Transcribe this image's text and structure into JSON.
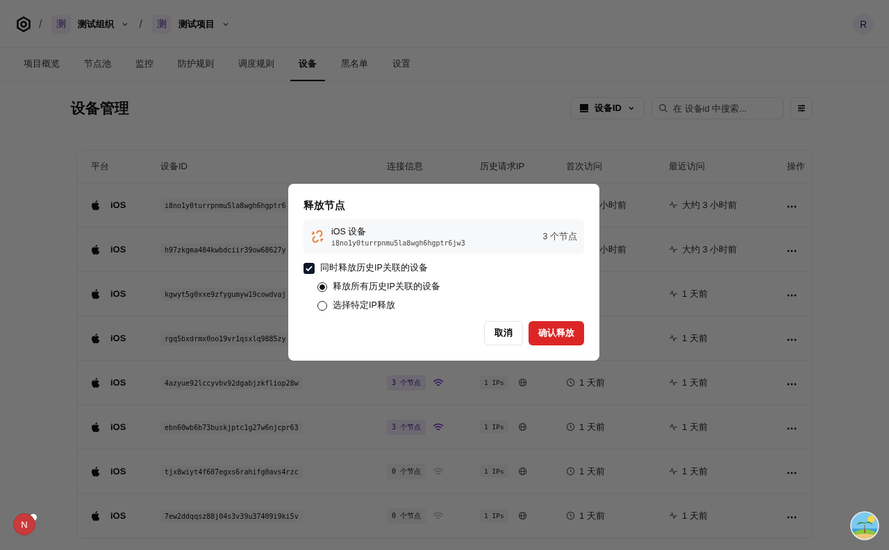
{
  "topbar": {
    "separator": "/",
    "org": {
      "badge": "测",
      "name": "测试组织"
    },
    "project": {
      "badge": "测",
      "name": "测试项目"
    },
    "avatar": "R"
  },
  "tabs": [
    {
      "label": "项目概览",
      "selected": false
    },
    {
      "label": "节点池",
      "selected": false
    },
    {
      "label": "监控",
      "selected": false
    },
    {
      "label": "防护规则",
      "selected": false
    },
    {
      "label": "调度规则",
      "selected": false
    },
    {
      "label": "设备",
      "selected": true
    },
    {
      "label": "黑名单",
      "selected": false
    },
    {
      "label": "设置",
      "selected": false
    }
  ],
  "page": {
    "title": "设备管理",
    "filter": "设备ID",
    "search": {
      "placeholder": "在 设备id 中搜索..."
    }
  },
  "table": {
    "columns": [
      "平台",
      "设备ID",
      "连接信息",
      "历史请求IP",
      "首次访问",
      "最近访问",
      "操作"
    ],
    "rows": [
      {
        "platform": "iOS",
        "device_id": "i8no1y0turrpnmu5la8wgh6hgptr6",
        "first_visit": "小时前",
        "last_visit": "大约 3 小时前"
      },
      {
        "platform": "iOS",
        "device_id": "h97zkgma484kwbdciir39ow68627y",
        "first_visit": "小时前",
        "last_visit": "大约 3 小时前"
      },
      {
        "platform": "iOS",
        "device_id": "kgwyt5g0xxe9zfygumyw19cowdvaj",
        "last_visit": "1 天前"
      },
      {
        "platform": "iOS",
        "device_id": "rgq5bxdrmx0oo19vr1qsxlq9885zy",
        "last_visit": "1 天前"
      },
      {
        "platform": "iOS",
        "device_id": "4azyue92lccyvbv92dgabjzkfliop28w",
        "nodes": "3 个节点",
        "online": true,
        "ips": "1 IPs",
        "first_visit": "1 天前",
        "last_visit": "1 天前"
      },
      {
        "platform": "iOS",
        "device_id": "ebn60wb6b73buskjptc1g27w6njcpr63",
        "nodes": "3 个节点",
        "online": true,
        "ips": "1 IPs",
        "first_visit": "1 天前",
        "last_visit": "1 天前"
      },
      {
        "platform": "iOS",
        "device_id": "tjx8wiyt4f607egxs6rahifg0avs4rzc",
        "nodes": "0 个节点",
        "online": false,
        "ips": "1 IPs",
        "first_visit": "1 天前",
        "last_visit": "1 天前"
      },
      {
        "platform": "iOS",
        "device_id": "7ew2ddqqsz88j04s3v39u37409i9ki5v",
        "nodes": "0 个节点",
        "online": false,
        "ips": "1 IPs",
        "first_visit": "1 天前",
        "last_visit": "1 天前"
      }
    ]
  },
  "dialog": {
    "title": "释放节点",
    "device": {
      "name": "iOS 设备",
      "id": "i8no1y0turrpnmu5la8wgh6hgptr6jw3",
      "nodes": "3 个节点"
    },
    "checkbox": {
      "label": "同时释放历史IP关联的设备",
      "checked": true
    },
    "options": [
      {
        "label": "释放所有历史IP关联的设备",
        "selected": true
      },
      {
        "label": "选择特定IP释放",
        "selected": false
      }
    ],
    "cancel": "取消",
    "confirm": "确认释放"
  },
  "dev_badge": "N"
}
